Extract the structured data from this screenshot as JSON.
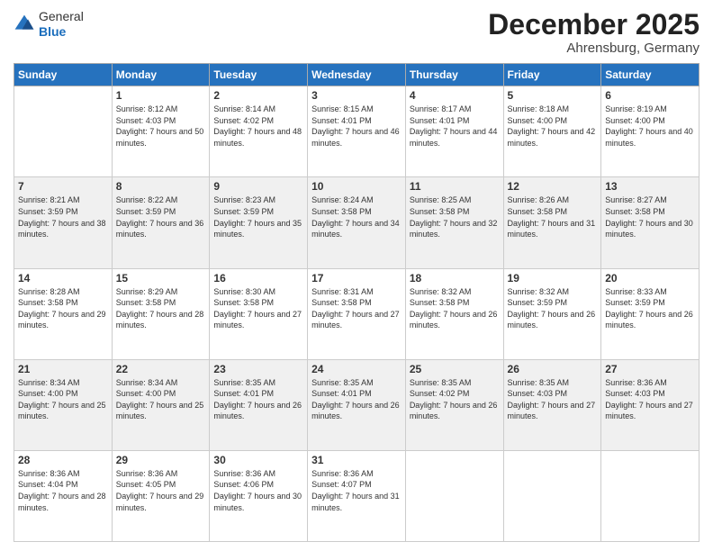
{
  "header": {
    "logo": {
      "general": "General",
      "blue": "Blue"
    },
    "title": "December 2025",
    "location": "Ahrensburg, Germany"
  },
  "days_of_week": [
    "Sunday",
    "Monday",
    "Tuesday",
    "Wednesday",
    "Thursday",
    "Friday",
    "Saturday"
  ],
  "weeks": [
    [
      {
        "day": "",
        "sunrise": "",
        "sunset": "",
        "daylight": ""
      },
      {
        "day": "1",
        "sunrise": "Sunrise: 8:12 AM",
        "sunset": "Sunset: 4:03 PM",
        "daylight": "Daylight: 7 hours and 50 minutes."
      },
      {
        "day": "2",
        "sunrise": "Sunrise: 8:14 AM",
        "sunset": "Sunset: 4:02 PM",
        "daylight": "Daylight: 7 hours and 48 minutes."
      },
      {
        "day": "3",
        "sunrise": "Sunrise: 8:15 AM",
        "sunset": "Sunset: 4:01 PM",
        "daylight": "Daylight: 7 hours and 46 minutes."
      },
      {
        "day": "4",
        "sunrise": "Sunrise: 8:17 AM",
        "sunset": "Sunset: 4:01 PM",
        "daylight": "Daylight: 7 hours and 44 minutes."
      },
      {
        "day": "5",
        "sunrise": "Sunrise: 8:18 AM",
        "sunset": "Sunset: 4:00 PM",
        "daylight": "Daylight: 7 hours and 42 minutes."
      },
      {
        "day": "6",
        "sunrise": "Sunrise: 8:19 AM",
        "sunset": "Sunset: 4:00 PM",
        "daylight": "Daylight: 7 hours and 40 minutes."
      }
    ],
    [
      {
        "day": "7",
        "sunrise": "Sunrise: 8:21 AM",
        "sunset": "Sunset: 3:59 PM",
        "daylight": "Daylight: 7 hours and 38 minutes."
      },
      {
        "day": "8",
        "sunrise": "Sunrise: 8:22 AM",
        "sunset": "Sunset: 3:59 PM",
        "daylight": "Daylight: 7 hours and 36 minutes."
      },
      {
        "day": "9",
        "sunrise": "Sunrise: 8:23 AM",
        "sunset": "Sunset: 3:59 PM",
        "daylight": "Daylight: 7 hours and 35 minutes."
      },
      {
        "day": "10",
        "sunrise": "Sunrise: 8:24 AM",
        "sunset": "Sunset: 3:58 PM",
        "daylight": "Daylight: 7 hours and 34 minutes."
      },
      {
        "day": "11",
        "sunrise": "Sunrise: 8:25 AM",
        "sunset": "Sunset: 3:58 PM",
        "daylight": "Daylight: 7 hours and 32 minutes."
      },
      {
        "day": "12",
        "sunrise": "Sunrise: 8:26 AM",
        "sunset": "Sunset: 3:58 PM",
        "daylight": "Daylight: 7 hours and 31 minutes."
      },
      {
        "day": "13",
        "sunrise": "Sunrise: 8:27 AM",
        "sunset": "Sunset: 3:58 PM",
        "daylight": "Daylight: 7 hours and 30 minutes."
      }
    ],
    [
      {
        "day": "14",
        "sunrise": "Sunrise: 8:28 AM",
        "sunset": "Sunset: 3:58 PM",
        "daylight": "Daylight: 7 hours and 29 minutes."
      },
      {
        "day": "15",
        "sunrise": "Sunrise: 8:29 AM",
        "sunset": "Sunset: 3:58 PM",
        "daylight": "Daylight: 7 hours and 28 minutes."
      },
      {
        "day": "16",
        "sunrise": "Sunrise: 8:30 AM",
        "sunset": "Sunset: 3:58 PM",
        "daylight": "Daylight: 7 hours and 27 minutes."
      },
      {
        "day": "17",
        "sunrise": "Sunrise: 8:31 AM",
        "sunset": "Sunset: 3:58 PM",
        "daylight": "Daylight: 7 hours and 27 minutes."
      },
      {
        "day": "18",
        "sunrise": "Sunrise: 8:32 AM",
        "sunset": "Sunset: 3:58 PM",
        "daylight": "Daylight: 7 hours and 26 minutes."
      },
      {
        "day": "19",
        "sunrise": "Sunrise: 8:32 AM",
        "sunset": "Sunset: 3:59 PM",
        "daylight": "Daylight: 7 hours and 26 minutes."
      },
      {
        "day": "20",
        "sunrise": "Sunrise: 8:33 AM",
        "sunset": "Sunset: 3:59 PM",
        "daylight": "Daylight: 7 hours and 26 minutes."
      }
    ],
    [
      {
        "day": "21",
        "sunrise": "Sunrise: 8:34 AM",
        "sunset": "Sunset: 4:00 PM",
        "daylight": "Daylight: 7 hours and 25 minutes."
      },
      {
        "day": "22",
        "sunrise": "Sunrise: 8:34 AM",
        "sunset": "Sunset: 4:00 PM",
        "daylight": "Daylight: 7 hours and 25 minutes."
      },
      {
        "day": "23",
        "sunrise": "Sunrise: 8:35 AM",
        "sunset": "Sunset: 4:01 PM",
        "daylight": "Daylight: 7 hours and 26 minutes."
      },
      {
        "day": "24",
        "sunrise": "Sunrise: 8:35 AM",
        "sunset": "Sunset: 4:01 PM",
        "daylight": "Daylight: 7 hours and 26 minutes."
      },
      {
        "day": "25",
        "sunrise": "Sunrise: 8:35 AM",
        "sunset": "Sunset: 4:02 PM",
        "daylight": "Daylight: 7 hours and 26 minutes."
      },
      {
        "day": "26",
        "sunrise": "Sunrise: 8:35 AM",
        "sunset": "Sunset: 4:03 PM",
        "daylight": "Daylight: 7 hours and 27 minutes."
      },
      {
        "day": "27",
        "sunrise": "Sunrise: 8:36 AM",
        "sunset": "Sunset: 4:03 PM",
        "daylight": "Daylight: 7 hours and 27 minutes."
      }
    ],
    [
      {
        "day": "28",
        "sunrise": "Sunrise: 8:36 AM",
        "sunset": "Sunset: 4:04 PM",
        "daylight": "Daylight: 7 hours and 28 minutes."
      },
      {
        "day": "29",
        "sunrise": "Sunrise: 8:36 AM",
        "sunset": "Sunset: 4:05 PM",
        "daylight": "Daylight: 7 hours and 29 minutes."
      },
      {
        "day": "30",
        "sunrise": "Sunrise: 8:36 AM",
        "sunset": "Sunset: 4:06 PM",
        "daylight": "Daylight: 7 hours and 30 minutes."
      },
      {
        "day": "31",
        "sunrise": "Sunrise: 8:36 AM",
        "sunset": "Sunset: 4:07 PM",
        "daylight": "Daylight: 7 hours and 31 minutes."
      },
      {
        "day": "",
        "sunrise": "",
        "sunset": "",
        "daylight": ""
      },
      {
        "day": "",
        "sunrise": "",
        "sunset": "",
        "daylight": ""
      },
      {
        "day": "",
        "sunrise": "",
        "sunset": "",
        "daylight": ""
      }
    ]
  ]
}
